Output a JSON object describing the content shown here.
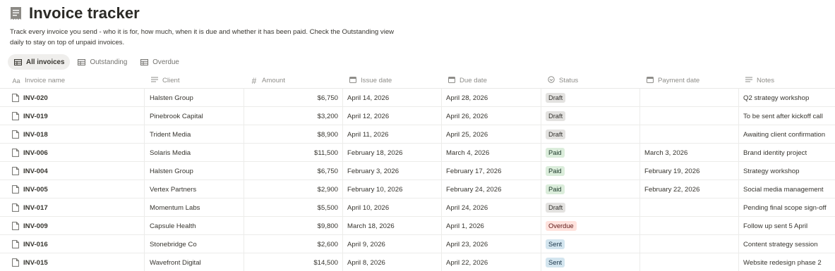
{
  "page": {
    "title": "Invoice tracker",
    "icon": "receipt-icon",
    "description": "Track every invoice you send - who it is for, how much, when it is due and whether it has been paid. Check the Outstanding view daily to stay on top of unpaid invoices."
  },
  "tabs": [
    {
      "label": "All invoices",
      "icon": "table-icon",
      "active": true
    },
    {
      "label": "Outstanding",
      "icon": "table-icon",
      "active": false
    },
    {
      "label": "Overdue",
      "icon": "table-icon",
      "active": false
    }
  ],
  "columns": [
    {
      "label": "Invoice name",
      "icon": "Aa"
    },
    {
      "label": "Client",
      "icon": "≡"
    },
    {
      "label": "Amount",
      "icon": "#"
    },
    {
      "label": "Issue date",
      "icon": "calendar"
    },
    {
      "label": "Due date",
      "icon": "calendar"
    },
    {
      "label": "Status",
      "icon": "status"
    },
    {
      "label": "Payment date",
      "icon": "calendar"
    },
    {
      "label": "Notes",
      "icon": "≡"
    }
  ],
  "status_colors": {
    "Draft": {
      "bg": "#e3e2e0",
      "fg": "#32302c"
    },
    "Paid": {
      "bg": "#dbeddb",
      "fg": "#1c3829"
    },
    "Overdue": {
      "bg": "#ffe2dd",
      "fg": "#5d1715"
    },
    "Sent": {
      "bg": "#d3e5ef",
      "fg": "#183347"
    }
  },
  "rows": [
    {
      "name": "INV-020",
      "client": "Halsten Group",
      "amount": "$6,750",
      "issue": "April 14, 2026",
      "due": "April 28, 2026",
      "status": "Draft",
      "payment": "",
      "notes": "Q2 strategy workshop"
    },
    {
      "name": "INV-019",
      "client": "Pinebrook Capital",
      "amount": "$3,200",
      "issue": "April 12, 2026",
      "due": "April 26, 2026",
      "status": "Draft",
      "payment": "",
      "notes": "To be sent after kickoff call"
    },
    {
      "name": "INV-018",
      "client": "Trident Media",
      "amount": "$8,900",
      "issue": "April 11, 2026",
      "due": "April 25, 2026",
      "status": "Draft",
      "payment": "",
      "notes": "Awaiting client confirmation"
    },
    {
      "name": "INV-006",
      "client": "Solaris Media",
      "amount": "$11,500",
      "issue": "February 18, 2026",
      "due": "March 4, 2026",
      "status": "Paid",
      "payment": "March 3, 2026",
      "notes": "Brand identity project"
    },
    {
      "name": "INV-004",
      "client": "Halsten Group",
      "amount": "$6,750",
      "issue": "February 3, 2026",
      "due": "February 17, 2026",
      "status": "Paid",
      "payment": "February 19, 2026",
      "notes": "Strategy workshop"
    },
    {
      "name": "INV-005",
      "client": "Vertex Partners",
      "amount": "$2,900",
      "issue": "February 10, 2026",
      "due": "February 24, 2026",
      "status": "Paid",
      "payment": "February 22, 2026",
      "notes": "Social media management"
    },
    {
      "name": "INV-017",
      "client": "Momentum Labs",
      "amount": "$5,500",
      "issue": "April 10, 2026",
      "due": "April 24, 2026",
      "status": "Draft",
      "payment": "",
      "notes": "Pending final scope sign-off"
    },
    {
      "name": "INV-009",
      "client": "Capsule Health",
      "amount": "$9,800",
      "issue": "March 18, 2026",
      "due": "April 1, 2026",
      "status": "Overdue",
      "payment": "",
      "notes": "Follow up sent 5 April"
    },
    {
      "name": "INV-016",
      "client": "Stonebridge Co",
      "amount": "$2,600",
      "issue": "April 9, 2026",
      "due": "April 23, 2026",
      "status": "Sent",
      "payment": "",
      "notes": "Content strategy session"
    },
    {
      "name": "INV-015",
      "client": "Wavefront Digital",
      "amount": "$14,500",
      "issue": "April 8, 2026",
      "due": "April 22, 2026",
      "status": "Sent",
      "payment": "",
      "notes": "Website redesign phase 2"
    }
  ]
}
